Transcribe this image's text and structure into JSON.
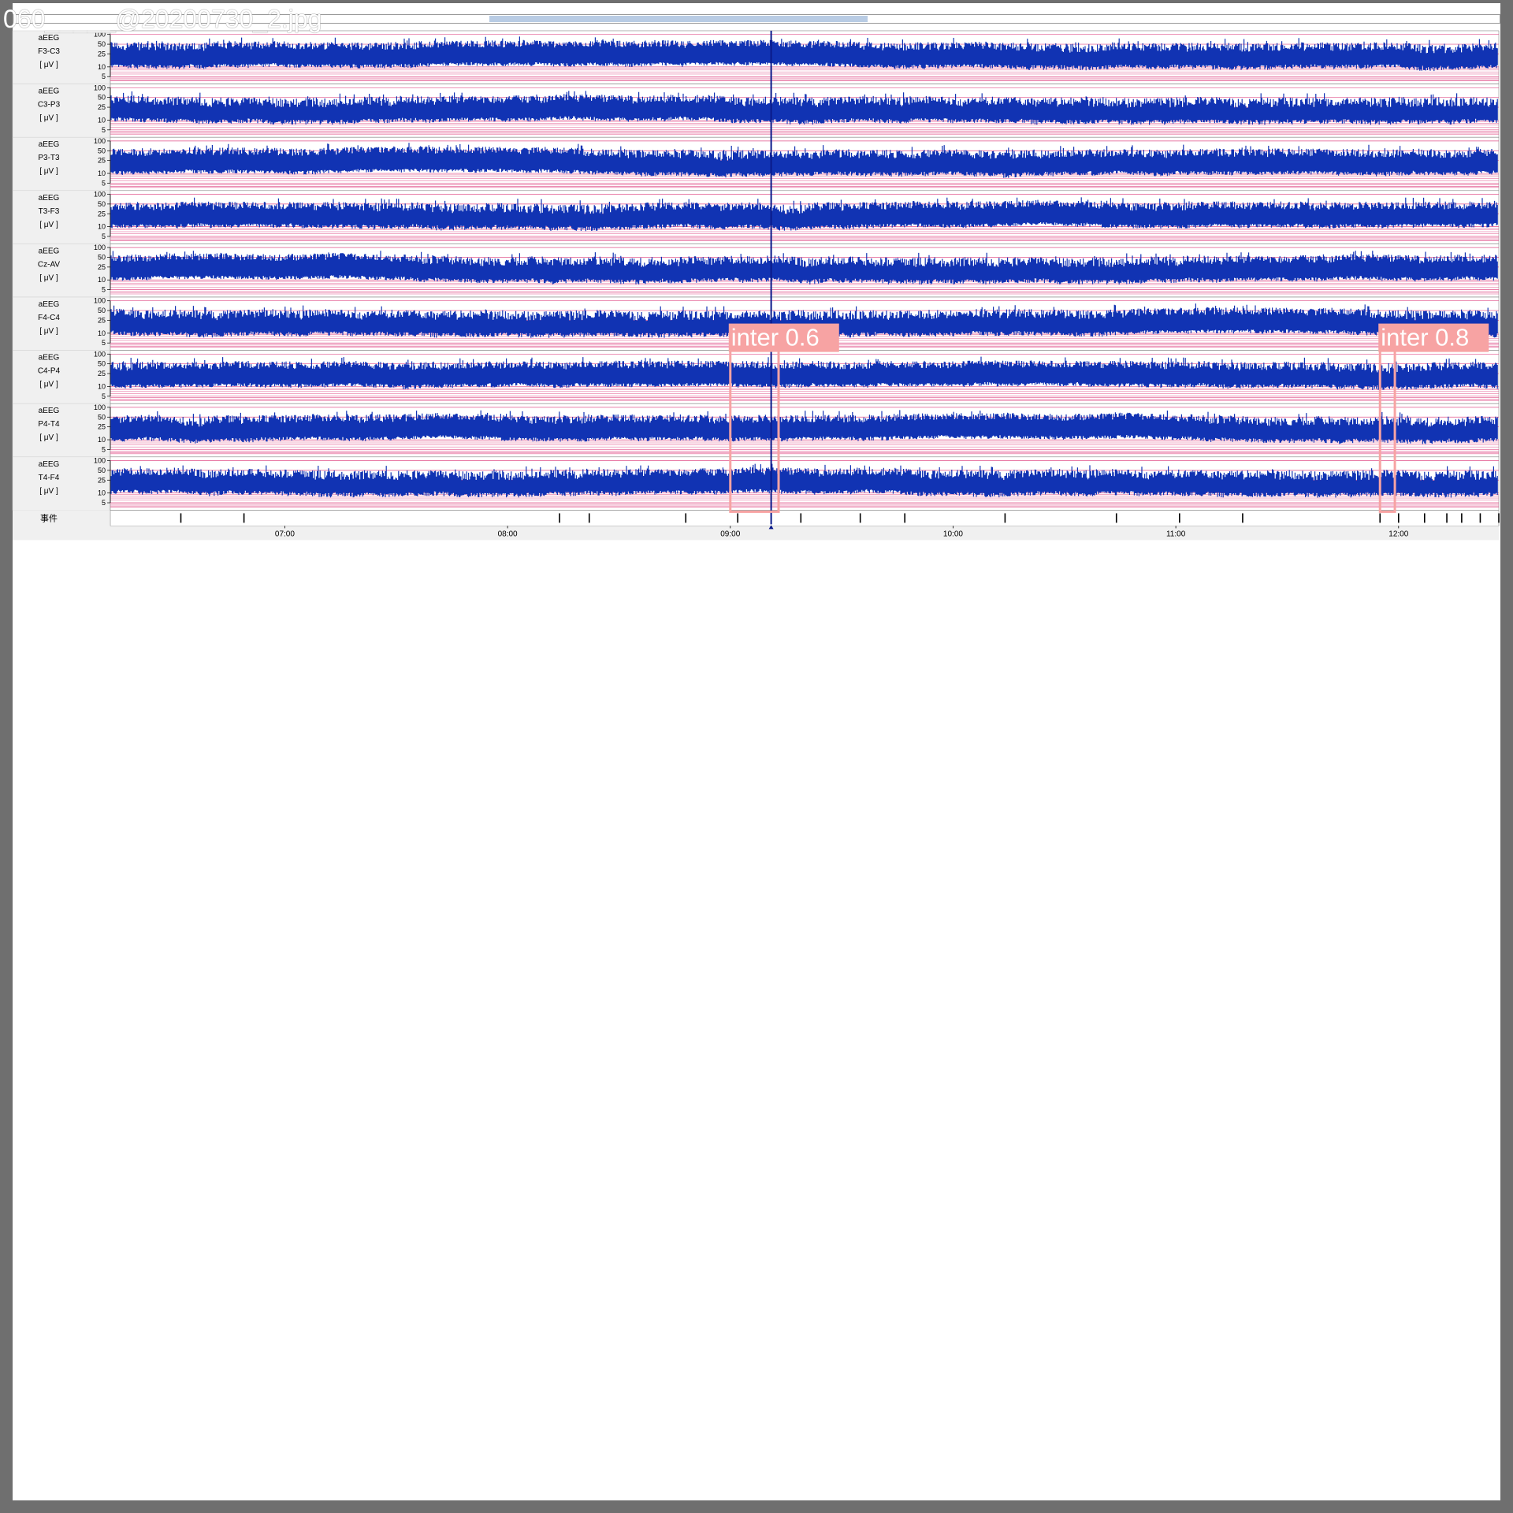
{
  "window": {
    "filename": "060_____@20200730_2.jpg"
  },
  "colors": {
    "signal": "#1133b3",
    "grid_pink": "#e0508a",
    "detection_box": "#f7a3a3",
    "detection_label_bg": "#f7a3a3",
    "label_panel_bg": "#f0f0f0"
  },
  "chart_data": {
    "type": "line",
    "title": "",
    "xlabel": "",
    "ylabel": "",
    "y_scale": "log",
    "y_ticks": [
      100,
      50,
      25,
      10,
      5
    ],
    "x_start": "06:13",
    "x_end": "12:27",
    "x_tick_labels": [
      "07:00",
      "08:00",
      "09:00",
      "10:00",
      "11:00",
      "12:00"
    ],
    "channels": [
      {
        "name": "aEEG",
        "lead": "F3-C3",
        "unit": "[ μV ]"
      },
      {
        "name": "aEEG",
        "lead": "C3-P3",
        "unit": "[ μV ]"
      },
      {
        "name": "aEEG",
        "lead": "P3-T3",
        "unit": "[ μV ]"
      },
      {
        "name": "aEEG",
        "lead": "T3-F3",
        "unit": "[ μV ]"
      },
      {
        "name": "aEEG",
        "lead": "Cz-AV",
        "unit": "[ μV ]"
      },
      {
        "name": "aEEG",
        "lead": "F4-C4",
        "unit": "[ μV ]"
      },
      {
        "name": "aEEG",
        "lead": "C4-P4",
        "unit": "[ μV ]"
      },
      {
        "name": "aEEG",
        "lead": "P4-T4",
        "unit": "[ μV ]"
      },
      {
        "name": "aEEG",
        "lead": "T4-F4",
        "unit": "[ μV ]"
      }
    ],
    "events_label": "事件",
    "event_times": [
      "06:32",
      "06:49",
      "08:14",
      "08:22",
      "08:48",
      "09:02",
      "09:19",
      "09:35",
      "09:47",
      "10:14",
      "10:44",
      "11:01",
      "11:18",
      "11:55",
      "12:00",
      "12:07",
      "12:13",
      "12:17",
      "12:22",
      "12:27"
    ],
    "cursor_time": "09:11",
    "detections": [
      {
        "label": "inter 0.6",
        "class": "inter",
        "score": 0.6,
        "start": "09:00",
        "end": "09:13",
        "first_channel": 6,
        "last_channel": 8
      },
      {
        "label": "inter 0.8",
        "class": "inter",
        "score": 0.8,
        "start": "11:55",
        "end": "11:59",
        "first_channel": 6,
        "last_channel": 8
      }
    ]
  }
}
